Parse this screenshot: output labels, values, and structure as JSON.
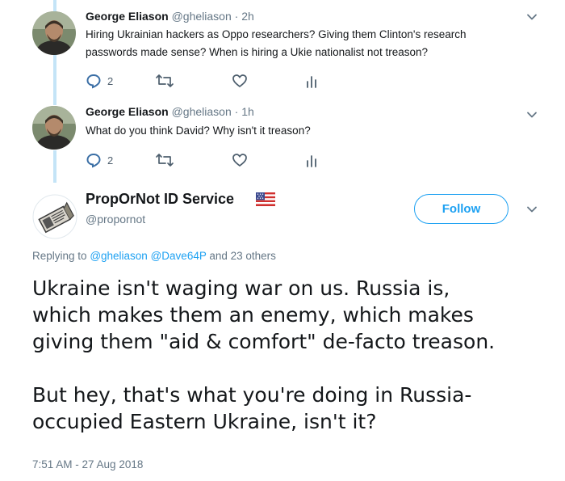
{
  "thread": [
    {
      "name": "George Eliason",
      "handle": "@gheliason",
      "separator": "·",
      "time": "2h",
      "text_lines": [
        "Hiring Ukrainian hackers as Oppo researchers? Giving them Clinton's research",
        "passwords made sense? When is hiring a Ukie nationalist not treason?"
      ],
      "reply_count": "2"
    },
    {
      "name": "George Eliason",
      "handle": "@gheliason",
      "separator": "·",
      "time": "1h",
      "text_lines": [
        "What do you think David? Why isn't it treason?"
      ],
      "reply_count": "2"
    }
  ],
  "main_tweet": {
    "name": "PropOrNot ID Service",
    "handle": "@propornot",
    "follow_label": "Follow",
    "replying_prefix": "Replying to",
    "mentions": [
      "@gheliason",
      "@Dave64P"
    ],
    "replying_suffix": "and 23 others",
    "body_paragraphs": [
      [
        "Ukraine isn't waging war on us. Russia is,",
        "which makes them an enemy, which makes",
        "giving them \"aid & comfort\" de-facto treason."
      ],
      [
        "But hey, that's what you're doing in Russia-",
        "occupied Eastern Ukraine, isn't it?"
      ]
    ],
    "timestamp": "7:51 AM - 27 Aug 2018"
  },
  "icons": {
    "reply": "reply-icon",
    "retweet": "retweet-icon",
    "like": "heart-icon",
    "analytics": "analytics-icon",
    "menu": "chevron-down-icon",
    "flag": "us-flag-icon"
  },
  "colors": {
    "accent": "#1da1f2",
    "thread_line": "#c4e4f7",
    "secondary_text": "#657786",
    "primary_text": "#14171a"
  }
}
